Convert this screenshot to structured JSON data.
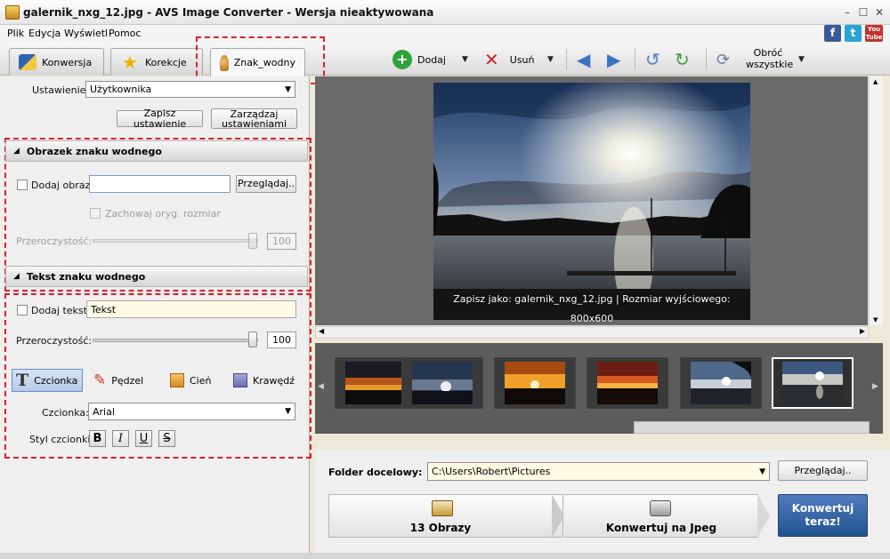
{
  "window": {
    "title": "galernik_nxg_12.jpg - AVS Image Converter - Wersja nieaktywowana"
  },
  "menu": [
    "Plik",
    "Edycja",
    "Wyświetl",
    "Pomoc"
  ],
  "social": {
    "facebook": "f",
    "twitter": "t",
    "youtube": "You Tube"
  },
  "tabs": [
    {
      "label": "Konwersja",
      "icon": "convert-icon"
    },
    {
      "label": "Korekcje",
      "icon": "star-icon"
    },
    {
      "label": "Znak_wodny",
      "icon": "stamp-icon"
    }
  ],
  "toolbar": {
    "add_label": "Dodaj",
    "remove_label": "Usuń",
    "rotate_all_label_1": "Obróć",
    "rotate_all_label_2": "wszystkie"
  },
  "settings": {
    "label": "Ustawienie:",
    "value": "Użytkownika",
    "save_label": "Zapisz ustawienie",
    "manage_label_1": "Zarządzaj",
    "manage_label_2": "ustawieniami"
  },
  "watermark_image": {
    "header": "Obrazek znaku wodnego",
    "add_image_label": "Dodaj obraz",
    "path_value": "",
    "browse_label": "Przeglądaj..",
    "keep_size_label": "Zachowaj oryg. rozmiar",
    "opacity_label": "Przeroczystość:",
    "opacity_value": "100"
  },
  "watermark_text": {
    "header": "Tekst znaku wodnego",
    "add_text_label": "Dodaj tekst:",
    "text_value": "Tekst",
    "opacity_label": "Przeroczystość:",
    "opacity_value": "100",
    "tools": [
      "Czcionka",
      "Pędzel",
      "Cień",
      "Krawędź"
    ],
    "font_label": "Czcionka:",
    "font_value": "Arial",
    "style_label": "Styl czcionki:",
    "styles": [
      "B",
      "I",
      "U",
      "S"
    ]
  },
  "preview": {
    "caption": "Zapisz jako: galernik_nxg_12.jpg | Rozmiar wyjściowego: 800x600"
  },
  "output": {
    "folder_label": "Folder docelowy:",
    "folder_value": "C:\\Users\\Robert\\Pictures",
    "browse_label": "Przeglądaj..",
    "step1": "13 Obrazy",
    "step2": "Konwertuj na Jpeg",
    "convert_label_1": "Konwertuj",
    "convert_label_2": "teraz!"
  },
  "colors": {
    "highlight_dash": "#dd1f2b",
    "convert_button": "#2d5ea3",
    "add_green": "#2fa33a",
    "remove_red": "#d1262b"
  }
}
